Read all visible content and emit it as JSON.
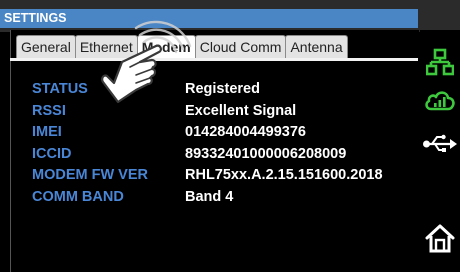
{
  "header": {
    "title": "SETTINGS"
  },
  "tabs": [
    {
      "label": "General",
      "active": false
    },
    {
      "label": "Ethernet",
      "active": false
    },
    {
      "label": "Modem",
      "active": true
    },
    {
      "label": "Cloud Comm",
      "active": false
    },
    {
      "label": "Antenna",
      "active": false
    }
  ],
  "modem": {
    "rows": [
      {
        "label": "STATUS",
        "value": "Registered"
      },
      {
        "label": "RSSI",
        "value": "Excellent Signal"
      },
      {
        "label": "IMEI",
        "value": "014284004499376"
      },
      {
        "label": "ICCID",
        "value": "89332401000006208009"
      },
      {
        "label": "MODEM FW VER",
        "value": "RHL75xx.A.2.15.151600.2018"
      },
      {
        "label": "COMM BAND",
        "value": "Band 4"
      }
    ]
  },
  "sidebar": {
    "icons": [
      "network-icon",
      "cloud-signal-icon",
      "usb-icon",
      "home-icon"
    ]
  },
  "overlay": {
    "icon": "tap-gesture-hand-icon"
  },
  "colors": {
    "title_bar": "#4a86c5",
    "label": "#4a86d6",
    "value": "#ffffff",
    "sidebar_icon": "#3ec83e",
    "home_icon": "#ffffff"
  }
}
